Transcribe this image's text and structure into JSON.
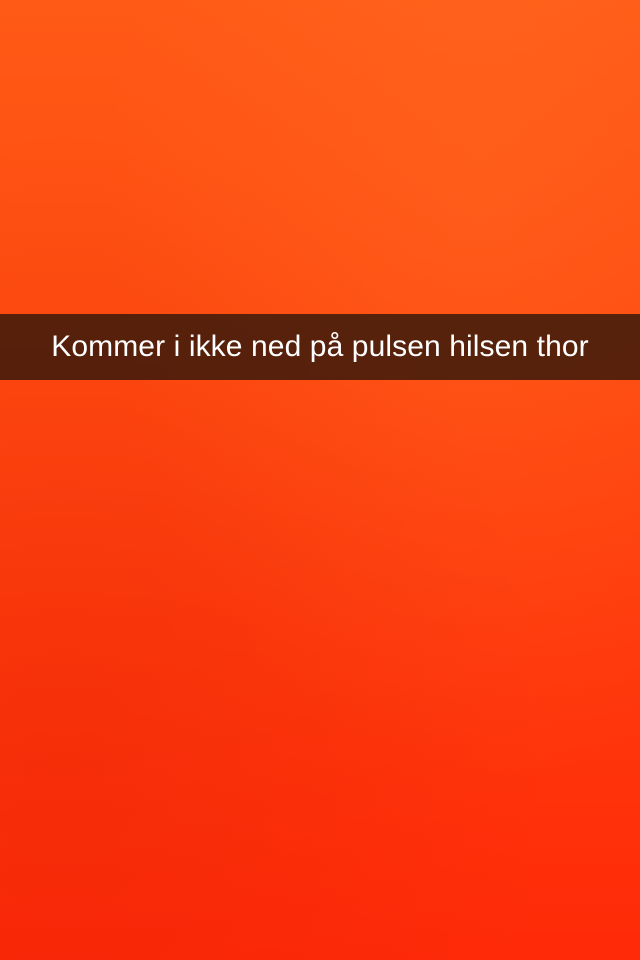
{
  "photo": {
    "background_color": "#ff4510",
    "caption": {
      "text": "Kommer i ikke ned på pulsen hilsen thor",
      "bar_color": "#28140a",
      "text_color": "#ffffff"
    }
  }
}
